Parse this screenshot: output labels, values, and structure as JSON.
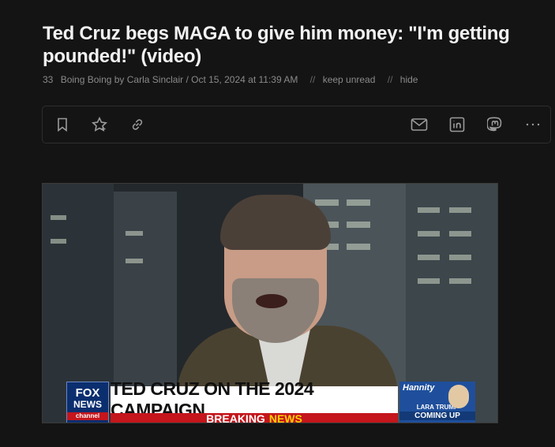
{
  "article": {
    "title": "Ted Cruz begs MAGA to give him money: \"I'm getting pounded!\" (video)",
    "count": "33",
    "byline": "Boing Boing by Carla Sinclair / Oct 15, 2024 at 11:39 AM",
    "keep_unread": "keep unread",
    "hide": "hide",
    "separator": "//"
  },
  "toolbar": {
    "icons": [
      "bookmark-icon",
      "star-icon",
      "link-icon",
      "mail-icon",
      "linkedin-icon",
      "mastodon-icon",
      "more-icon"
    ]
  },
  "video": {
    "chyron": "TED CRUZ ON THE 2024 CAMPAIGN",
    "breaking": "BREAKING",
    "news": "NEWS",
    "logo_line1": "FOX",
    "logo_line2": "NEWS",
    "logo_line3": "channel",
    "promo_show": "Hannity",
    "promo_guest": "LARA TRUMP",
    "promo_when": "COMING UP"
  },
  "colors": {
    "background": "#141414",
    "title": "#f2f2f2",
    "meta": "#8a8a8a",
    "breaking_red": "#c4161c",
    "news_yellow": "#ffd200",
    "fox_blue": "#0b2e6f"
  }
}
